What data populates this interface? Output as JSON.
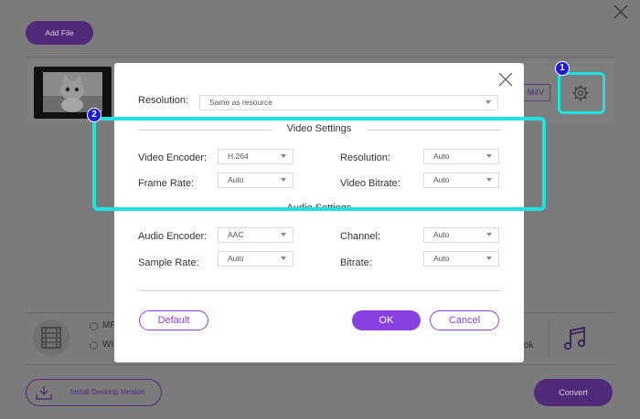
{
  "app": {
    "add_file_label": "Add File",
    "format_tag": "M4V",
    "format_options_partial": [
      "MP",
      "WI"
    ],
    "right_text_partial": "ok",
    "install_label": "Install Desktop Version",
    "convert_label": "Convert"
  },
  "dialog": {
    "resolution_label": "Resolution:",
    "resolution_value": "Same as resource",
    "video_section_title": "Video Settings",
    "video_encoder_label": "Video Encoder:",
    "video_encoder_value": "H.264",
    "video_resolution_label": "Resolution:",
    "video_resolution_value": "Auto",
    "frame_rate_label": "Frame Rate:",
    "frame_rate_value": "Auto",
    "video_bitrate_label": "Video Bitrate:",
    "video_bitrate_value": "Auto",
    "audio_section_title": "Audio Settings",
    "audio_encoder_label": "Audio Encoder:",
    "audio_encoder_value": "AAC",
    "channel_label": "Channel:",
    "channel_value": "Auto",
    "sample_rate_label": "Sample Rate:",
    "sample_rate_value": "Auto",
    "bitrate_label": "Bitrate:",
    "bitrate_value": "Auto",
    "default_label": "Default",
    "ok_label": "OK",
    "cancel_label": "Cancel"
  },
  "annotations": {
    "badge_1": "1",
    "badge_2": "2",
    "highlight_color": "#1de2e3"
  },
  "colors": {
    "accent": "#8a3fe0",
    "overlay_bg": "#7b7b7b"
  }
}
